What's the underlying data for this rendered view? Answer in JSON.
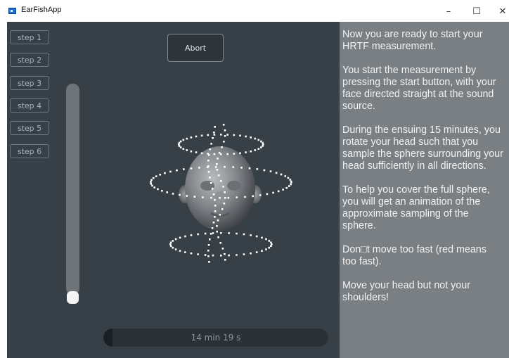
{
  "window": {
    "title": "EarFishApp",
    "controls": {
      "minimize": "–",
      "maximize": "☐",
      "close": "✕"
    }
  },
  "steps": [
    "step 1",
    "step 2",
    "step 3",
    "step 4",
    "step 5",
    "step 6"
  ],
  "abort_label": "Abort",
  "slider": {
    "level_fraction": 0.0
  },
  "progress": {
    "label": "14 min 19 s",
    "fraction": 0.04
  },
  "instructions": [
    [
      "Now you are ready to start your",
      "HRTF measurement."
    ],
    [
      "You start the measurement by",
      "pressing the start button, with your",
      "face directed straight at the sound",
      "source."
    ],
    [
      "During the ensuing 15 minutes, you",
      "rotate your head such that you",
      "sample the sphere surrounding your",
      "head sufficiently in all directions."
    ],
    [
      "To help you cover the full sphere,",
      "you will get an animation of the",
      "approximate sampling of the",
      "sphere."
    ],
    [
      "Don□t move too fast (red means",
      "too fast)."
    ],
    [
      "Move your head but not your",
      "shoulders!"
    ]
  ],
  "colors": {
    "background": "#374047",
    "panel": "#7a7f84",
    "sample_dot": "#ffffff"
  }
}
